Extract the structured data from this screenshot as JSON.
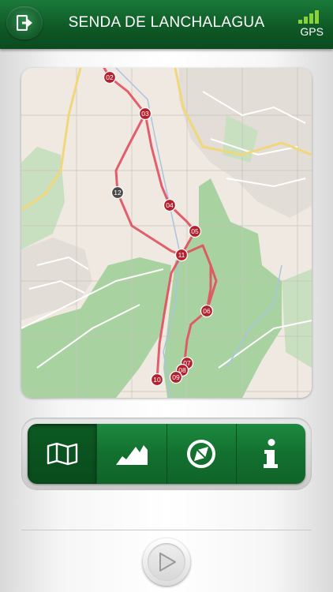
{
  "header": {
    "title": "SENDA DE LANCHALAGUA",
    "gps_label": "GPS",
    "icons": {
      "back": "exit-icon",
      "gps": "signal-bars-icon"
    }
  },
  "map": {
    "waypoints": [
      "02",
      "03",
      "04",
      "05",
      "06",
      "07",
      "08",
      "09",
      "10",
      "11",
      "12"
    ]
  },
  "tabs": [
    {
      "id": "map",
      "icon": "map-icon"
    },
    {
      "id": "profile",
      "icon": "elevation-profile-icon"
    },
    {
      "id": "compass",
      "icon": "compass-icon"
    },
    {
      "id": "info",
      "icon": "info-icon"
    }
  ],
  "player": {
    "icon": "play-icon"
  },
  "colors": {
    "brand_green": "#13702f",
    "gps_green": "#8bd13a",
    "route_red": "#e25060",
    "marker_red": "#b3202e"
  }
}
